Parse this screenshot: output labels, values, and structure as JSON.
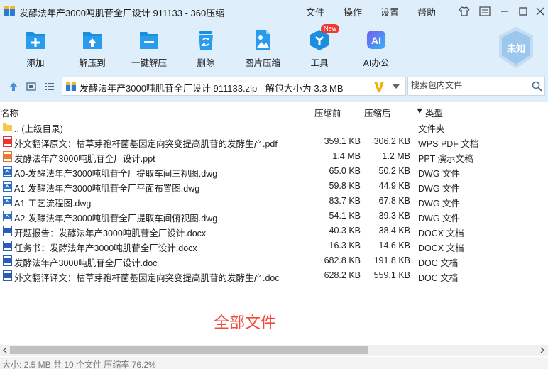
{
  "window": {
    "title": "发酵法年产3000吨肌苷全厂设计 911133 - 360压缩",
    "menu": [
      "文件",
      "操作",
      "设置",
      "帮助"
    ]
  },
  "toolbar": {
    "items": [
      {
        "label": "添加",
        "icon": "add-icon"
      },
      {
        "label": "解压到",
        "icon": "extract-to-icon"
      },
      {
        "label": "一键解压",
        "icon": "one-click-extract-icon"
      },
      {
        "label": "删除",
        "icon": "delete-icon"
      },
      {
        "label": "图片压缩",
        "icon": "image-compress-icon"
      },
      {
        "label": "工具",
        "icon": "tools-icon",
        "badge": "New"
      },
      {
        "label": "AI办公",
        "icon": "ai-office-icon",
        "icon_text": "AI"
      }
    ],
    "shield_label": "未知"
  },
  "address": {
    "path": "发酵法年产3000吨肌苷全厂设计 911133.zip - 解包大小为 3.3 MB",
    "search_placeholder": "搜索包内文件"
  },
  "list": {
    "columns": {
      "name": "名称",
      "size": "压缩前",
      "compressed": "压缩后",
      "type": "类型"
    },
    "sort_indicator": "▼",
    "rows": [
      {
        "name": ".. (上级目录)",
        "size": "",
        "compressed": "",
        "type": "文件夹",
        "icon": "folder"
      },
      {
        "name": "外文翻译原文：枯草芽孢杆菌基因定向突变提高肌苷的发酵生产.pdf",
        "size": "359.1 KB",
        "compressed": "306.2 KB",
        "type": "WPS PDF 文档",
        "icon": "pdf"
      },
      {
        "name": "发酵法年产3000吨肌苷全厂设计.ppt",
        "size": "1.4 MB",
        "compressed": "1.2 MB",
        "type": "PPT 演示文稿",
        "icon": "ppt"
      },
      {
        "name": "A0-发酵法年产3000吨肌苷全厂提取车间三视图.dwg",
        "size": "65.0 KB",
        "compressed": "50.2 KB",
        "type": "DWG 文件",
        "icon": "dwg"
      },
      {
        "name": "A1-发酵法年产3000吨肌苷全厂平面布置图.dwg",
        "size": "59.8 KB",
        "compressed": "44.9 KB",
        "type": "DWG 文件",
        "icon": "dwg"
      },
      {
        "name": "A1-工艺流程图.dwg",
        "size": "83.7 KB",
        "compressed": "67.8 KB",
        "type": "DWG 文件",
        "icon": "dwg"
      },
      {
        "name": "A2-发酵法年产3000吨肌苷全厂提取车间俯视图.dwg",
        "size": "54.1 KB",
        "compressed": "39.3 KB",
        "type": "DWG 文件",
        "icon": "dwg"
      },
      {
        "name": "开题报告：发酵法年产3000吨肌苷全厂设计.docx",
        "size": "40.3 KB",
        "compressed": "38.4 KB",
        "type": "DOCX 文档",
        "icon": "doc"
      },
      {
        "name": "任务书：发酵法年产3000吨肌苷全厂设计.docx",
        "size": "16.3 KB",
        "compressed": "14.6 KB",
        "type": "DOCX 文档",
        "icon": "doc"
      },
      {
        "name": "发酵法年产3000吨肌苷全厂设计.doc",
        "size": "682.8 KB",
        "compressed": "191.8 KB",
        "type": "DOC 文档",
        "icon": "doc"
      },
      {
        "name": "外文翻译译文：枯草芽孢杆菌基因定向突变提高肌苷的发酵生产.doc",
        "size": "628.2 KB",
        "compressed": "559.1 KB",
        "type": "DOC 文档",
        "icon": "doc"
      }
    ]
  },
  "watermark": "全部文件",
  "status": "大小: 2.5 MB 共 10 个文件 压缩率 76.2%",
  "colors": {
    "accent": "#1a8fe0",
    "titlebar_bg": "#dfeefb",
    "watermark": "#f04a3a"
  }
}
